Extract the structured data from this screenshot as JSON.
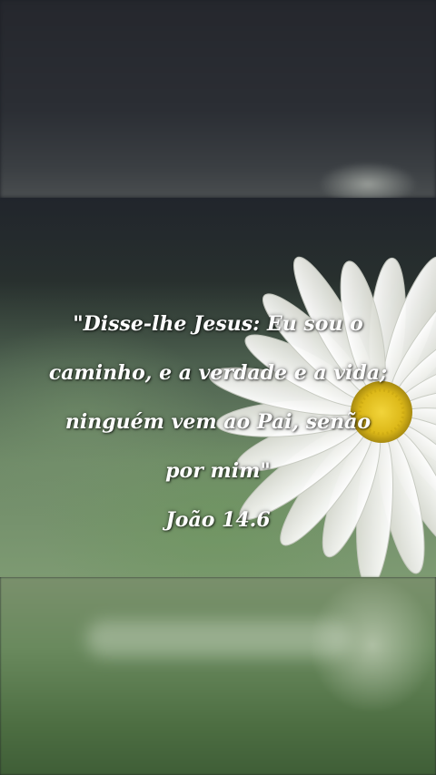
{
  "verse": {
    "lines": [
      "\"Disse-lhe Jesus: Eu sou o",
      "caminho, e a verdade e a vida;",
      "ninguém vem ao Pai, senão",
      "por mim\""
    ],
    "reference": "João 14.6"
  },
  "colors": {
    "text": "#ffffff",
    "petal": "#f1f1ea",
    "flower_center": "#e3c21a",
    "background_green": "#6f8a68"
  }
}
